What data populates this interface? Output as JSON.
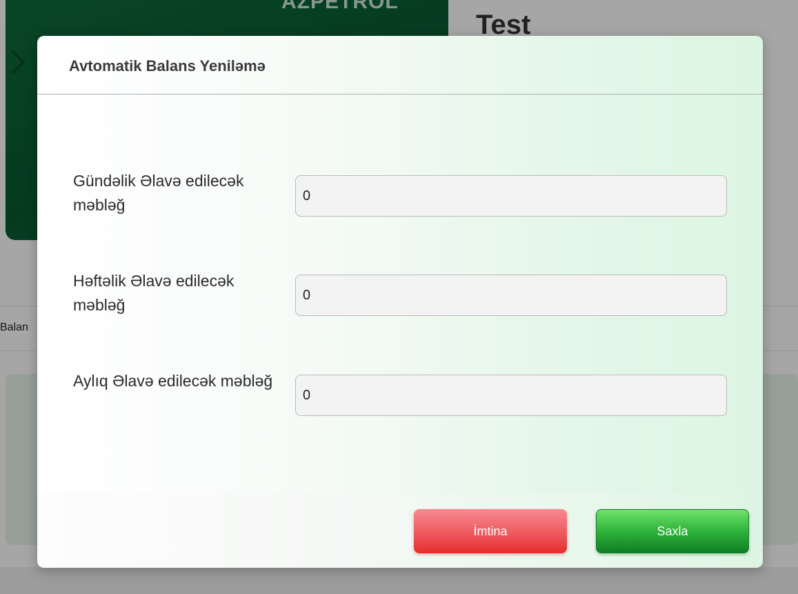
{
  "background": {
    "brand_logo": "AZPETROL",
    "page_title": "Test",
    "tab_label": "Balan"
  },
  "modal": {
    "title": "Avtomatik Balans Yeniləmə",
    "fields": [
      {
        "label": "Gündəlik Əlavə edilecək məbləğ",
        "value": "0"
      },
      {
        "label": "Həftəlik Əlavə edilecək məbləğ",
        "value": "0"
      },
      {
        "label": "Aylıq Əlavə edilecək məbləğ",
        "value": "0"
      }
    ],
    "cancel_label": "İmtina",
    "save_label": "Saxla"
  },
  "colors": {
    "cancel_button": "#ee5a5f",
    "save_button": "#2fb33a",
    "banner": "#0b6b3a"
  }
}
